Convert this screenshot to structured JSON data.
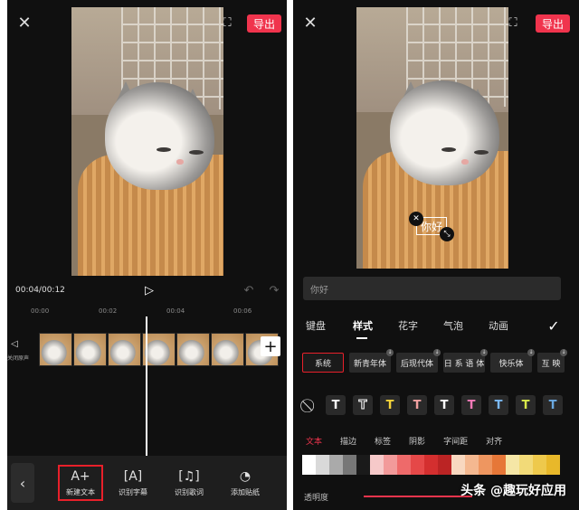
{
  "left": {
    "export_label": "导出",
    "time_display": "00:04/00:12",
    "ticks": [
      "00:00",
      "00:02",
      "00:04",
      "00:06"
    ],
    "audio_label": "关闭原声",
    "toolbar": [
      {
        "label": "新建文本",
        "icon": "text-add-icon",
        "glyph": "A+"
      },
      {
        "label": "识别字幕",
        "icon": "caption-scan-icon",
        "glyph": "[A]"
      },
      {
        "label": "识别歌词",
        "icon": "lyrics-scan-icon",
        "glyph": "[♫]"
      },
      {
        "label": "添加贴纸",
        "icon": "sticker-icon",
        "glyph": "◔"
      }
    ]
  },
  "right": {
    "export_label": "导出",
    "overlay_text": "你好",
    "input_value": "你好",
    "tabs": [
      "键盘",
      "样式",
      "花字",
      "气泡",
      "动画"
    ],
    "active_tab": "样式",
    "fonts": [
      "系统",
      "新青年体",
      "后现代体",
      "日 系 语 体",
      "快乐体",
      "互 映"
    ],
    "selected_font": "系统",
    "style_colors": [
      "#ffffff",
      "#ffffff",
      "#f5d33a",
      "#f0a0a0",
      "#ffffff",
      "#f47ab8",
      "#7ab8f4",
      "#d8e84a",
      "#6aa8e0"
    ],
    "subtabs": [
      "文本",
      "描边",
      "标签",
      "阴影",
      "字间距",
      "对齐"
    ],
    "active_subtab": "文本",
    "swatch_colors": [
      "#ffffff",
      "#d9d9d9",
      "#aaaaaa",
      "#777777",
      "#1a1a1a",
      "#f6c9c9",
      "#f29a9a",
      "#ee6a6a",
      "#e54848",
      "#d42f2f",
      "#bb2424",
      "#f8d8c0",
      "#f4b890",
      "#ee9660",
      "#e67738",
      "#f5e6a6",
      "#f2da78",
      "#eec94c",
      "#e8b82a"
    ],
    "opacity_label": "透明度"
  },
  "watermark": "头条 @趣玩好应用"
}
